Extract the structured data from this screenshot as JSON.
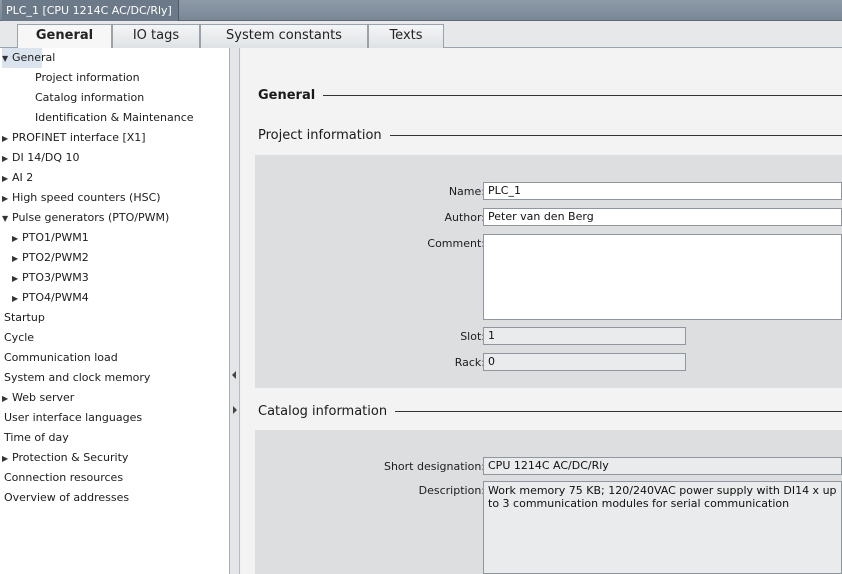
{
  "window": {
    "title": "PLC_1 [CPU 1214C AC/DC/Rly]"
  },
  "tabs": [
    {
      "label": "General"
    },
    {
      "label": "IO tags"
    },
    {
      "label": "System constants"
    },
    {
      "label": "Texts"
    }
  ],
  "sidebar": {
    "items": [
      {
        "label": "General",
        "arrow": "▼"
      },
      {
        "label": "Project information"
      },
      {
        "label": "Catalog information"
      },
      {
        "label": "Identification & Maintenance"
      },
      {
        "label": "PROFINET interface [X1]",
        "arrow": "▶"
      },
      {
        "label": "DI 14/DQ 10",
        "arrow": "▶"
      },
      {
        "label": "AI 2",
        "arrow": "▶"
      },
      {
        "label": "High speed counters (HSC)",
        "arrow": "▶"
      },
      {
        "label": "Pulse generators (PTO/PWM)",
        "arrow": "▼"
      },
      {
        "label": "PTO1/PWM1",
        "arrow": "▶"
      },
      {
        "label": "PTO2/PWM2",
        "arrow": "▶"
      },
      {
        "label": "PTO3/PWM3",
        "arrow": "▶"
      },
      {
        "label": "PTO4/PWM4",
        "arrow": "▶"
      },
      {
        "label": "Startup"
      },
      {
        "label": "Cycle"
      },
      {
        "label": "Communication load"
      },
      {
        "label": "System and clock memory"
      },
      {
        "label": "Web server",
        "arrow": "▶"
      },
      {
        "label": "User interface languages"
      },
      {
        "label": "Time of day"
      },
      {
        "label": "Protection & Security",
        "arrow": "▶"
      },
      {
        "label": "Connection resources"
      },
      {
        "label": "Overview of addresses"
      }
    ]
  },
  "main": {
    "general_heading": "General",
    "project_info": {
      "heading": "Project information",
      "name_label": "Name:",
      "name_value": "PLC_1",
      "author_label": "Author:",
      "author_value": "Peter van den Berg",
      "comment_label": "Comment:",
      "comment_value": "",
      "slot_label": "Slot:",
      "slot_value": "1",
      "rack_label": "Rack:",
      "rack_value": "0"
    },
    "catalog_info": {
      "heading": "Catalog information",
      "short_label": "Short designation:",
      "short_value": "CPU 1214C AC/DC/Rly",
      "desc_label": "Description:",
      "desc_value": "Work memory 75 KB; 120/240VAC power supply with DI14 x up to 3 communication modules for serial communication"
    }
  },
  "colors": {
    "titlebar": "#7a8796",
    "selection": "#dbe4ee",
    "panel": "#dcdee0"
  }
}
